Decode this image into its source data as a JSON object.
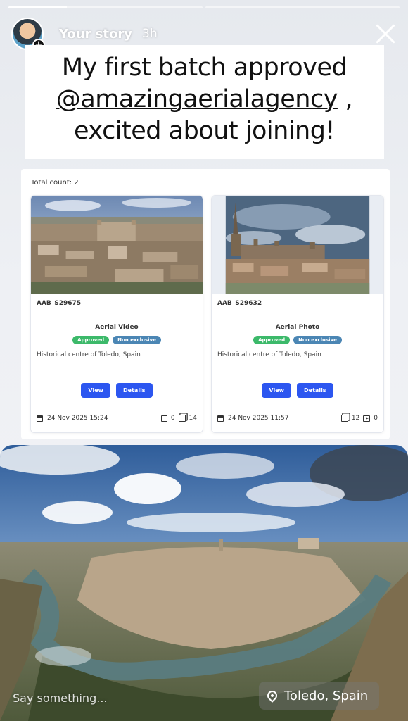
{
  "story": {
    "progress_fractions": [
      0.3,
      0,
      0
    ],
    "username": "Your story",
    "time": "3h"
  },
  "caption": {
    "line1": "My first batch approved",
    "mention": "@amazingaerialagency",
    "line2_suffix": " ,",
    "line3": "excited about joining!"
  },
  "panel": {
    "total_count": "Total count: 2",
    "cards": [
      {
        "code": "AAB_S29675",
        "type": "Aerial Video",
        "status": "Approved",
        "exclusivity": "Non exclusive",
        "location": "Historical centre of Toledo, Spain",
        "view_label": "View",
        "details_label": "Details",
        "date": "24 Nov 2025 15:24",
        "count_a": "0",
        "count_b": "14"
      },
      {
        "code": "AAB_S29632",
        "type": "Aerial Photo",
        "status": "Approved",
        "exclusivity": "Non exclusive",
        "location": "Historical centre of Toledo, Spain",
        "view_label": "View",
        "details_label": "Details",
        "date": "24 Nov 2025 11:57",
        "count_a": "12",
        "count_b": "0"
      }
    ]
  },
  "footer": {
    "message_placeholder": "Say something...",
    "location": "Toledo, Spain"
  },
  "colors": {
    "approved": "#3cb96a",
    "non_exclusive": "#4b86b4",
    "button": "#2c56f0"
  }
}
